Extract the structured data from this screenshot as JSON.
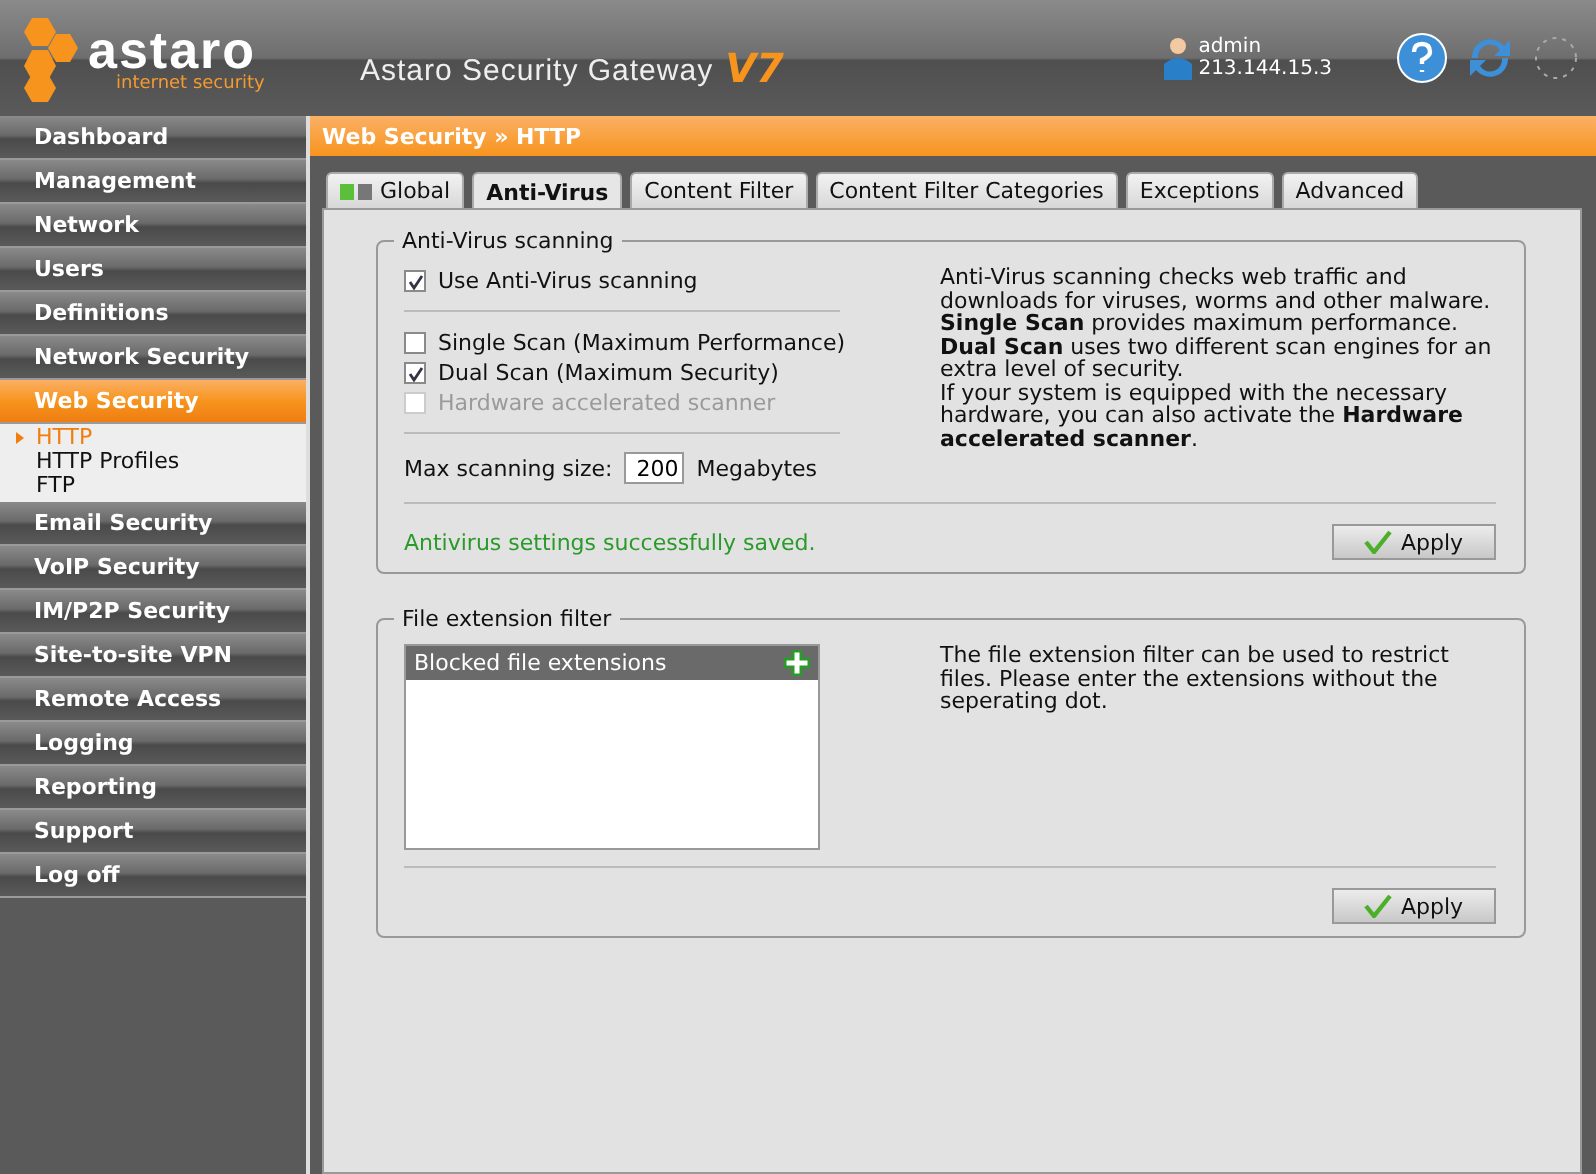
{
  "header": {
    "logo_name": "astaro",
    "logo_tagline": "internet security",
    "title": "Astaro Security Gateway",
    "version": "V7",
    "user": "admin",
    "ip": "213.144.15.3"
  },
  "sidebar": {
    "items": [
      {
        "label": "Dashboard",
        "selected": false
      },
      {
        "label": "Management",
        "selected": false
      },
      {
        "label": "Network",
        "selected": false
      },
      {
        "label": "Users",
        "selected": false
      },
      {
        "label": "Definitions",
        "selected": false
      },
      {
        "label": "Network Security",
        "selected": false
      },
      {
        "label": "Web Security",
        "selected": true,
        "children": [
          {
            "label": "HTTP",
            "selected": true
          },
          {
            "label": "HTTP Profiles",
            "selected": false
          },
          {
            "label": "FTP",
            "selected": false
          }
        ]
      },
      {
        "label": "Email Security",
        "selected": false
      },
      {
        "label": "VoIP Security",
        "selected": false
      },
      {
        "label": "IM/P2P Security",
        "selected": false
      },
      {
        "label": "Site-to-site VPN",
        "selected": false
      },
      {
        "label": "Remote Access",
        "selected": false
      },
      {
        "label": "Logging",
        "selected": false
      },
      {
        "label": "Reporting",
        "selected": false
      },
      {
        "label": "Support",
        "selected": false
      },
      {
        "label": "Log off",
        "selected": false
      }
    ]
  },
  "breadcrumb": "Web Security » HTTP",
  "tabs": [
    {
      "label": "Global",
      "selected": false,
      "icon": true
    },
    {
      "label": "Anti-Virus",
      "selected": true
    },
    {
      "label": "Content Filter",
      "selected": false
    },
    {
      "label": "Content Filter Categories",
      "selected": false
    },
    {
      "label": "Exceptions",
      "selected": false
    },
    {
      "label": "Advanced",
      "selected": false
    }
  ],
  "antivirus": {
    "title": "Anti-Virus scanning",
    "use_scanning": {
      "label": "Use Anti-Virus scanning",
      "checked": true
    },
    "scan_modes": [
      {
        "label": "Single Scan (Maximum Performance)",
        "checked": false,
        "disabled": false
      },
      {
        "label": "Dual Scan (Maximum Security)",
        "checked": true,
        "disabled": false
      },
      {
        "label": "Hardware accelerated scanner",
        "checked": false,
        "disabled": true
      }
    ],
    "max_size_label": "Max scanning size:",
    "max_size_value": "200",
    "max_size_unit": "Megabytes",
    "description": [
      "Anti-Virus scanning checks web traffic and downloads for viruses, worms and other malware. **Single Scan** provides maximum performance. **Dual Scan** uses two different scan engines for an extra level of security.",
      "If your system is equipped with the necessary hardware, you can also activate the **Hardware accelerated scanner**."
    ],
    "status": "Antivirus settings successfully saved.",
    "apply": "Apply"
  },
  "file_filter": {
    "title": "File extension filter",
    "list_title": "Blocked file extensions",
    "description": "The file extension filter can be used to restrict files. Please enter the extensions without the seperating dot.",
    "apply": "Apply"
  }
}
